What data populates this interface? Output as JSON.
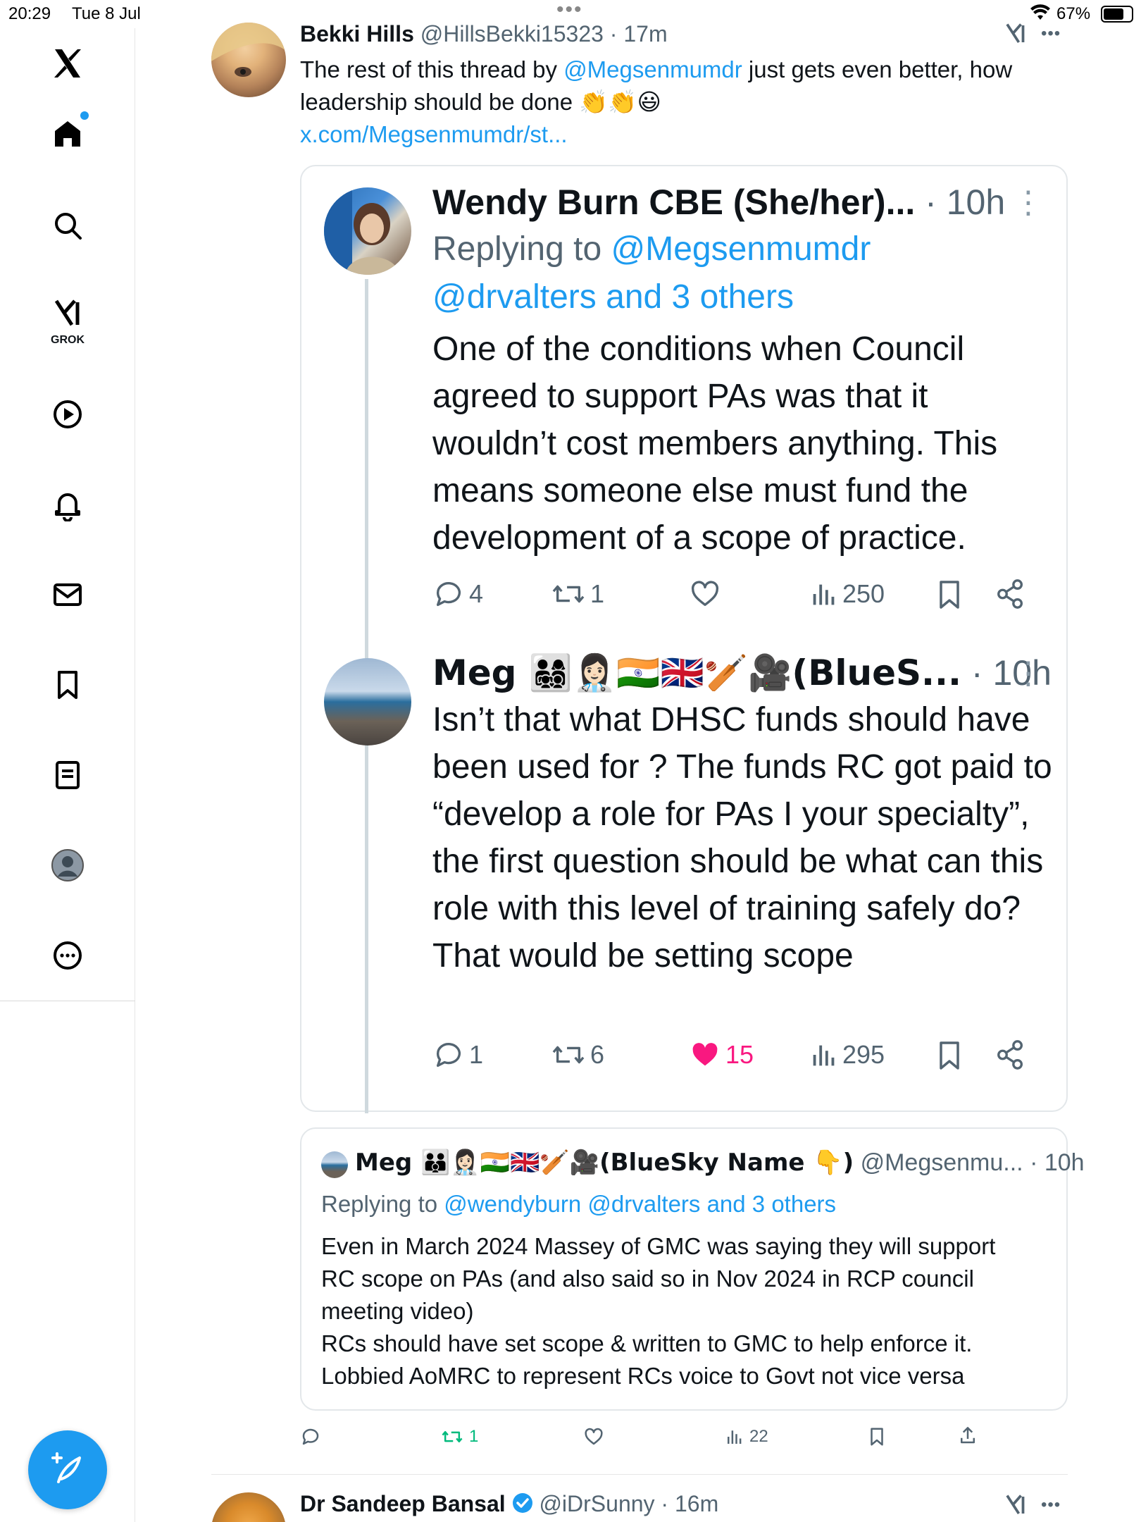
{
  "status_bar": {
    "time": "20:29",
    "date": "Tue 8 Jul",
    "battery": "67%"
  },
  "sidebar": {
    "items": [
      "x-logo",
      "home",
      "search",
      "grok",
      "video",
      "notifications",
      "messages",
      "bookmarks",
      "lists",
      "profile",
      "more"
    ],
    "grok_label": "GROK"
  },
  "main_tweet": {
    "name": "Bekki Hills",
    "handle": "@HillsBekki15323",
    "time": "· 17m",
    "text_before": "The rest of this thread by ",
    "mention": "@Megsenmumdr",
    "text_after": " just gets even better, how leadership should be done ",
    "emoji": "👏👏😃",
    "link": "x.com/Megsenmumdr/st..."
  },
  "embedded": {
    "reply1": {
      "name": "Wendy Burn CBE (She/her)...",
      "time": " · 10h",
      "replying_label": "Replying to ",
      "replying_to": "@Megsenmumdr @drvalters and 3 others",
      "text": "One of the conditions when Council agreed to support PAs was that it wouldn’t cost members anything. This means someone else must fund the development of a scope of practice.",
      "replies": "4",
      "reposts": "1",
      "likes": "",
      "views": "250"
    },
    "reply2": {
      "name": "Meg 👨‍👩‍👧‍👦👩🏻‍⚕️🇮🇳🇬🇧🏏🎥(BlueS...",
      "time": " · 10h",
      "text": "Isn’t that what DHSC funds should have been used for ? The funds RC got paid to “develop a role for PAs I your specialty”, the first question should be what can this role with this level of training safely do? That would be setting scope",
      "replies": "1",
      "reposts": "6",
      "likes": "15",
      "views": "295"
    }
  },
  "quote": {
    "name": "Meg 👪👩🏻‍⚕️🇮🇳🇬🇧🏏🎥(BlueSky Name 👇)",
    "handle": " @Megsenmu... · 10h",
    "replying_label": "Replying to ",
    "replying_to": "@wendyburn @drvalters and 3 others",
    "text_lines": [
      "Even in March 2024 Massey of GMC was saying they will support",
      "RC scope on PAs (and also said so in Nov 2024 in RCP council",
      "meeting video)",
      "RCs should have set scope & written to GMC to help enforce it.",
      "Lobbied AoMRC to represent RCs voice to Govt not vice versa"
    ]
  },
  "main_actions": {
    "reposts": "1",
    "views": "22"
  },
  "next_tweet": {
    "name": "Dr Sandeep Bansal",
    "handle": "@iDrSunny",
    "time": "· 16m"
  },
  "colors": {
    "accent": "#1d9bf0",
    "like": "#f91880",
    "repost": "#00ba7c",
    "muted": "#536471"
  }
}
